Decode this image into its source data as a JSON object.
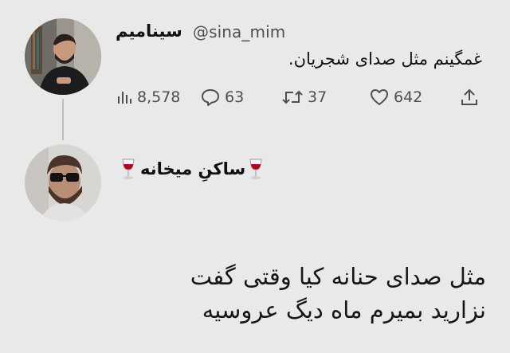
{
  "tweet": {
    "display_name": "سینامیم",
    "handle": "@sina_mim",
    "text": "غمگینم مثل صدای شجریان.",
    "stats": {
      "views": "8,578",
      "replies": "63",
      "retweets": "37",
      "likes": "642"
    },
    "icons": [
      "views-icon",
      "reply-icon",
      "retweet-icon",
      "like-icon",
      "share-icon"
    ]
  },
  "reply": {
    "display_name": "ساکنِ میخانه",
    "name_emoji": "wine-glass-icon",
    "text_lines": [
      "مثل صدای حنانه کیا وقتی گفت",
      "نزارید بمیرم ماه دیگ عروسیه"
    ]
  },
  "colors": {
    "background": "#e9e9e9",
    "text": "#111111",
    "muted": "#4f4f4f",
    "wine": "#b3001b"
  }
}
